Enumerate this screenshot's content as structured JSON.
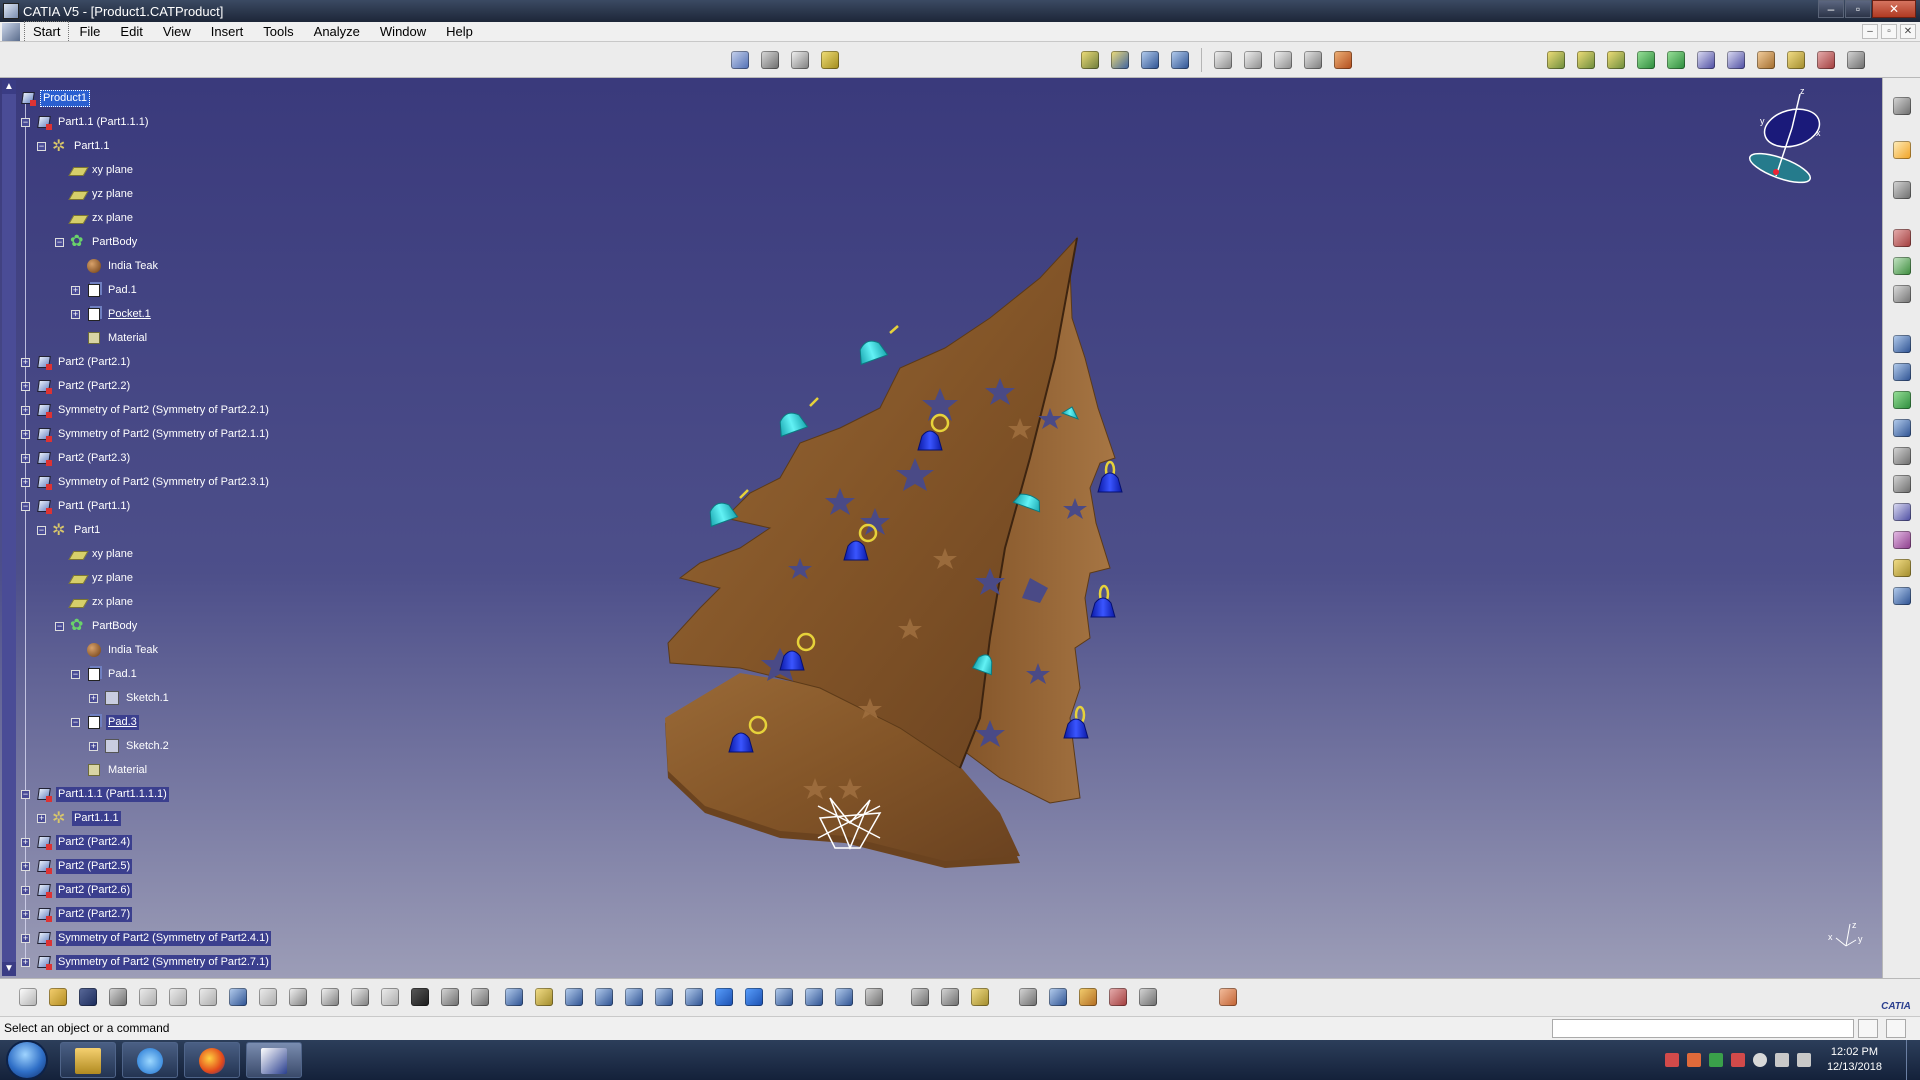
{
  "window": {
    "title": "CATIA V5 - [Product1.CATProduct]",
    "controls": [
      "–",
      "▫",
      "✕"
    ]
  },
  "menu": {
    "items": [
      "Start",
      "File",
      "Edit",
      "View",
      "Insert",
      "Tools",
      "Analyze",
      "Window",
      "Help"
    ],
    "mdi_controls": [
      "–",
      "▫",
      "✕"
    ]
  },
  "tree": {
    "nodes": [
      {
        "label": "Product1",
        "icon": "product-icon"
      },
      {
        "label": "Part1.1 (Part1.1.1)",
        "icon": "part-icon"
      },
      {
        "label": "Part1.1",
        "icon": "gear-icon"
      },
      {
        "label": "xy plane",
        "icon": "plane-icon"
      },
      {
        "label": "yz plane",
        "icon": "plane-icon"
      },
      {
        "label": "zx plane",
        "icon": "plane-icon"
      },
      {
        "label": "PartBody",
        "icon": "body-icon"
      },
      {
        "label": "India Teak",
        "icon": "material-icon"
      },
      {
        "label": "Pad.1",
        "icon": "pad-icon"
      },
      {
        "label": "Pocket.1",
        "icon": "pocket-icon"
      },
      {
        "label": "Material",
        "icon": "material-library-icon"
      },
      {
        "label": "Part2 (Part2.1)",
        "icon": "part-icon"
      },
      {
        "label": "Part2 (Part2.2)",
        "icon": "part-icon"
      },
      {
        "label": "Symmetry of Part2 (Symmetry of Part2.2.1)",
        "icon": "part-icon"
      },
      {
        "label": "Symmetry of Part2 (Symmetry of Part2.1.1)",
        "icon": "part-icon"
      },
      {
        "label": "Part2 (Part2.3)",
        "icon": "part-icon"
      },
      {
        "label": "Symmetry of Part2 (Symmetry of Part2.3.1)",
        "icon": "part-icon"
      },
      {
        "label": "Part1 (Part1.1)",
        "icon": "part-icon"
      },
      {
        "label": "Part1",
        "icon": "gear-icon"
      },
      {
        "label": "xy plane",
        "icon": "plane-icon"
      },
      {
        "label": "yz plane",
        "icon": "plane-icon"
      },
      {
        "label": "zx plane",
        "icon": "plane-icon"
      },
      {
        "label": "PartBody",
        "icon": "body-icon"
      },
      {
        "label": "India Teak",
        "icon": "material-icon"
      },
      {
        "label": "Pad.1",
        "icon": "pad-icon"
      },
      {
        "label": "Sketch.1",
        "icon": "sketch-icon"
      },
      {
        "label": "Pad.3",
        "icon": "pad-icon"
      },
      {
        "label": "Sketch.2",
        "icon": "sketch-icon"
      },
      {
        "label": "Material",
        "icon": "material-library-icon"
      },
      {
        "label": "Part1.1.1 (Part1.1.1.1)",
        "icon": "part-icon"
      },
      {
        "label": "Part1.1.1",
        "icon": "gear-icon"
      },
      {
        "label": "Part2 (Part2.4)",
        "icon": "part-icon"
      },
      {
        "label": "Part2 (Part2.5)",
        "icon": "part-icon"
      },
      {
        "label": "Part2 (Part2.6)",
        "icon": "part-icon"
      },
      {
        "label": "Part2 (Part2.7)",
        "icon": "part-icon"
      },
      {
        "label": "Symmetry of Part2 (Symmetry of Part2.4.1)",
        "icon": "part-icon"
      },
      {
        "label": "Symmetry of Part2 (Symmetry of Part2.7.1)",
        "icon": "part-icon"
      }
    ]
  },
  "viewport": {
    "compass_axes": [
      "x",
      "y",
      "z"
    ],
    "model": "christmas-tree-model"
  },
  "status": {
    "message": "Select an object or a command",
    "command_input": ""
  },
  "taskbar": {
    "apps": [
      "explorer-icon",
      "internet-explorer-icon",
      "firefox-icon",
      "catia-icon"
    ],
    "time": "12:02 PM",
    "date": "12/13/2018"
  },
  "colors": {
    "viewport_top": "#3a3a7c",
    "viewport_bottom": "#9c9db7",
    "wood": "#8a5a2b",
    "bell_blue": "#1a2fd8",
    "bell_cyan": "#36d0d8",
    "selection": "#2a5fd0"
  }
}
